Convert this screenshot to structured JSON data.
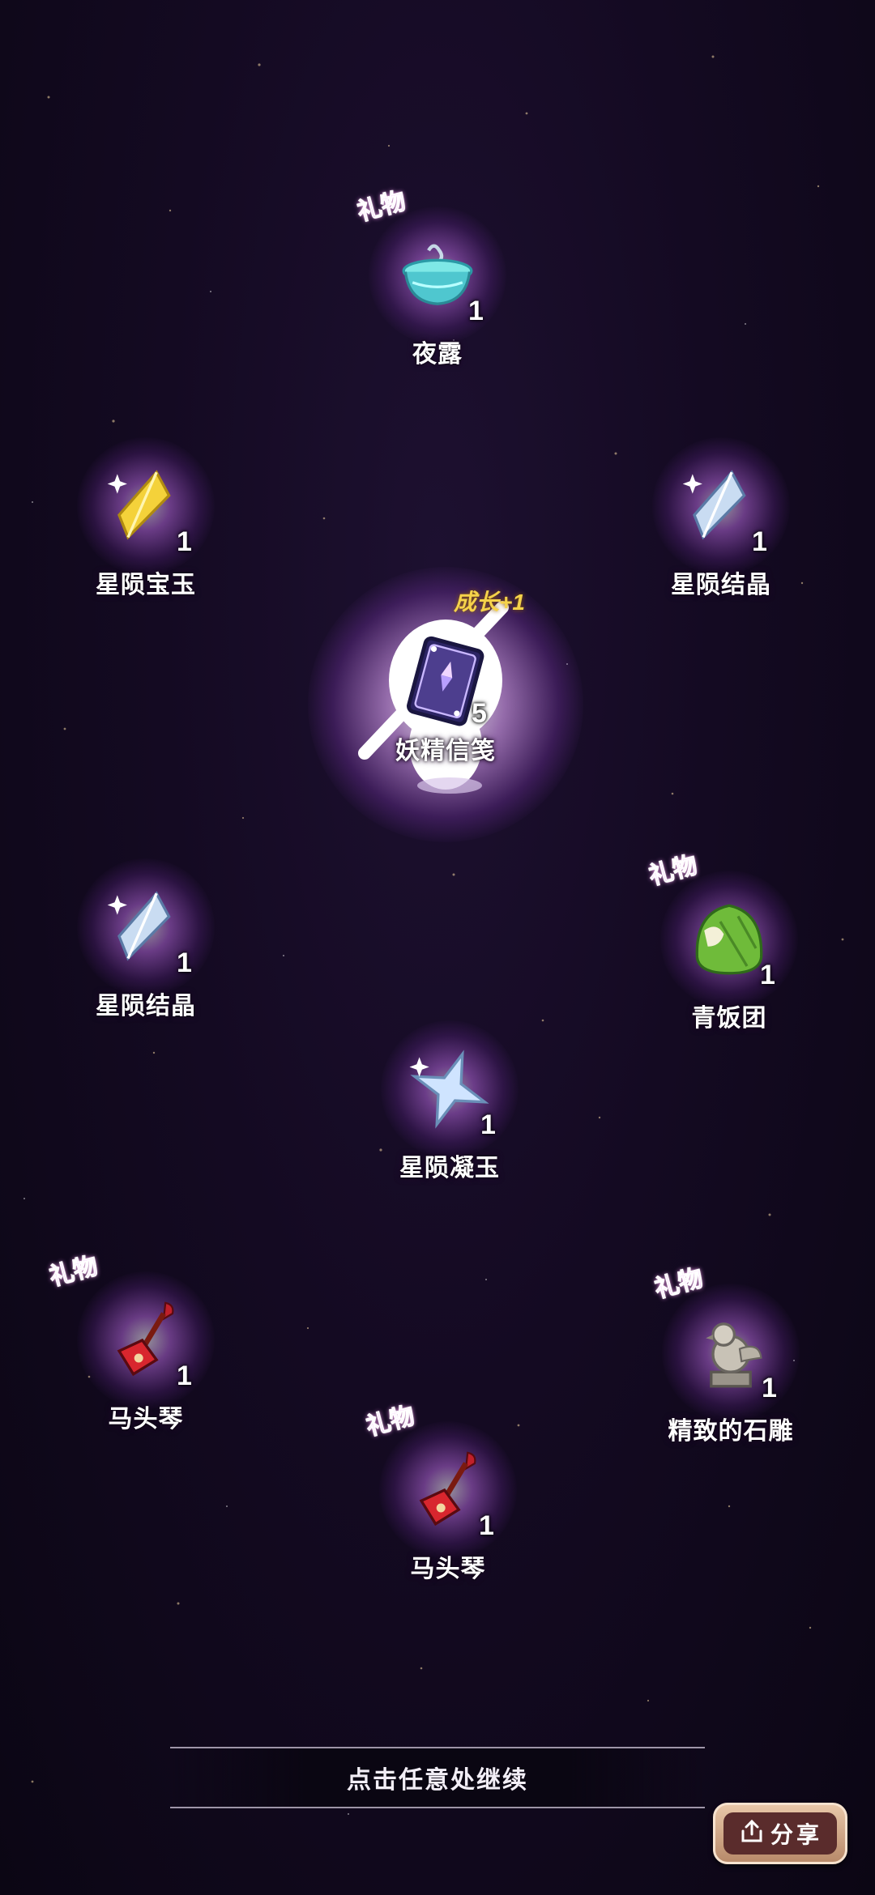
{
  "items": [
    {
      "name": "夜露",
      "count": "1",
      "gift": "礼物"
    },
    {
      "name": "星陨宝玉",
      "count": "1"
    },
    {
      "name": "星陨结晶",
      "count": "1"
    },
    {
      "name": "妖精信笺",
      "count": "5",
      "growth": "成长+1"
    },
    {
      "name": "星陨结晶",
      "count": "1"
    },
    {
      "name": "青饭团",
      "count": "1",
      "gift": "礼物"
    },
    {
      "name": "星陨凝玉",
      "count": "1"
    },
    {
      "name": "马头琴",
      "count": "1",
      "gift": "礼物"
    },
    {
      "name": "精致的石雕",
      "count": "1",
      "gift": "礼物"
    },
    {
      "name": "马头琴",
      "count": "1",
      "gift": "礼物"
    }
  ],
  "continue_prompt": "点击任意处继续",
  "share_label": "分享",
  "colors": {
    "gift": "#e25ff0",
    "growth": "#f5d24a",
    "background": "#140a22"
  }
}
